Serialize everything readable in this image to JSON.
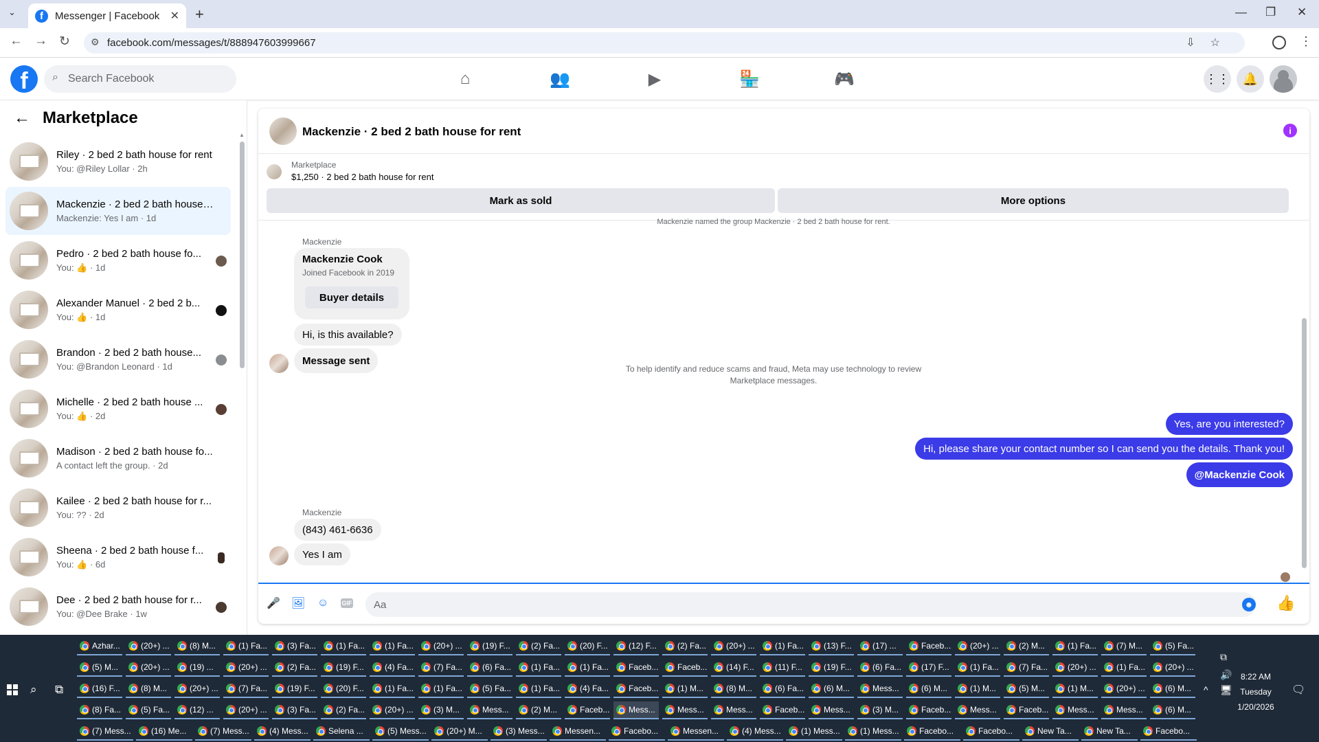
{
  "browser": {
    "tab_title": "Messenger | Facebook",
    "tab_favicon": "f",
    "url": "facebook.com/messages/t/888947603999667"
  },
  "fb": {
    "search_placeholder": "Search Facebook"
  },
  "sidebar": {
    "title": "Marketplace",
    "conversations": [
      {
        "name": "Riley · 2 bed 2 bath house for rent",
        "sub": "You: @Riley Lollar · 2h"
      },
      {
        "name": "Mackenzie · 2 bed 2 bath house ...",
        "sub": "Mackenzie: Yes I am · 1d"
      },
      {
        "name": "Pedro · 2 bed 2 bath house fo...",
        "sub": "You: 👍 · 1d"
      },
      {
        "name": "Alexander Manuel · 2 bed 2 b...",
        "sub": "You: 👍 · 1d"
      },
      {
        "name": "Brandon · 2 bed 2 bath house...",
        "sub": "You: @Brandon Leonard · 1d"
      },
      {
        "name": "Michelle · 2 bed 2 bath house ...",
        "sub": "You: 👍 · 2d"
      },
      {
        "name": "Madison · 2 bed 2 bath house fo...",
        "sub": "A contact left the group. · 2d"
      },
      {
        "name": "Kailee · 2 bed 2 bath house for r...",
        "sub": "You: ?? · 2d"
      },
      {
        "name": "Sheena · 2 bed 2 bath house f...",
        "sub": "You: 👍 · 6d"
      },
      {
        "name": "Dee · 2 bed 2 bath house for r...",
        "sub": "You: @Dee Brake · 1w"
      }
    ]
  },
  "chat": {
    "title": "Mackenzie · 2 bed 2 bath house for rent",
    "listing_category": "Marketplace",
    "listing_price": "$1,250 · 2 bed 2 bath house for rent",
    "mark_sold": "Mark as sold",
    "more_options": "More options",
    "cut_text": "Mackenzie named the group Mackenzie · 2 bed 2 bath house for rent.",
    "sender1": "Mackenzie",
    "card_name": "Mackenzie Cook",
    "card_joined": "Joined Facebook in 2019",
    "buyer_details": "Buyer details",
    "msg1": "Hi, is this available?",
    "msg2": "Message sent",
    "notice": "To help identify and reduce scams and fraud, Meta may use technology to review Marketplace messages.",
    "out1": "Yes, are you interested?",
    "out2": "Hi, please share your contact number so I can send you the details. Thank you!",
    "out3": "@Mackenzie Cook",
    "sender2": "Mackenzie",
    "msg3": "(843) 461-6636",
    "msg4": "Yes I am",
    "composer_placeholder": "Aa"
  },
  "taskbar": {
    "rows": [
      [
        "Azhar...",
        "(20+) ...",
        "(8) M...",
        "(1) Fa...",
        "(3) Fa...",
        "(1) Fa...",
        "(1) Fa...",
        "(20+) ...",
        "(19) F...",
        "(2) Fa...",
        "(20) F...",
        "(12) F...",
        "(2) Fa...",
        "(20+) ...",
        "(1) Fa...",
        "(13) F...",
        "(17) ...",
        "Faceb...",
        "(20+) ...",
        "(2) M...",
        "(1) Fa...",
        "(7) M...",
        "(5) Fa..."
      ],
      [
        "(5) M...",
        "(20+) ...",
        "(19) ...",
        "(20+) ...",
        "(2) Fa...",
        "(19) F...",
        "(4) Fa...",
        "(7) Fa...",
        "(6) Fa...",
        "(1) Fa...",
        "(1) Fa...",
        "Faceb...",
        "Faceb...",
        "(14) F...",
        "(11) F...",
        "(19) F...",
        "(6) Fa...",
        "(17) F...",
        "(1) Fa...",
        "(7) Fa...",
        "(20+) ...",
        "(1) Fa...",
        "(20+) ..."
      ],
      [
        "(16) F...",
        "(8) M...",
        "(20+) ...",
        "(7) Fa...",
        "(19) F...",
        "(20) F...",
        "(1) Fa...",
        "(1) Fa...",
        "(5) Fa...",
        "(1) Fa...",
        "(4) Fa...",
        "Faceb...",
        "(1) M...",
        "(8) M...",
        "(6) Fa...",
        "(6) M...",
        "Mess...",
        "(6) M...",
        "(1) M...",
        "(5) M...",
        "(1) M...",
        "(20+) ...",
        "(6) M..."
      ],
      [
        "(8) Fa...",
        "(5) Fa...",
        "(12) ...",
        "(20+) ...",
        "(3) Fa...",
        "(2) Fa...",
        "(20+) ...",
        "(3) M...",
        "Mess...",
        "(2) M...",
        "Faceb...",
        "Mess...",
        "Mess...",
        "Mess...",
        "Faceb...",
        "Mess...",
        "(3) M...",
        "Faceb...",
        "Mess...",
        "Faceb...",
        "Mess...",
        "Mess...",
        "(6) M..."
      ]
    ],
    "row5": [
      "(7) Mess...",
      "(16) Me...",
      "(7) Mess...",
      "(4) Mess...",
      "Selena ...",
      "(5) Mess...",
      "(20+) M...",
      "(3) Mess...",
      "Messen...",
      "Facebo...",
      "Messen...",
      "(4) Mess...",
      "(1) Mess...",
      "(1) Mess...",
      "Facebo...",
      "Facebo...",
      "New Ta...",
      "New Ta...",
      "Facebo..."
    ],
    "time": "8:22 AM",
    "day": "Tuesday",
    "date": "1/20/2026"
  }
}
